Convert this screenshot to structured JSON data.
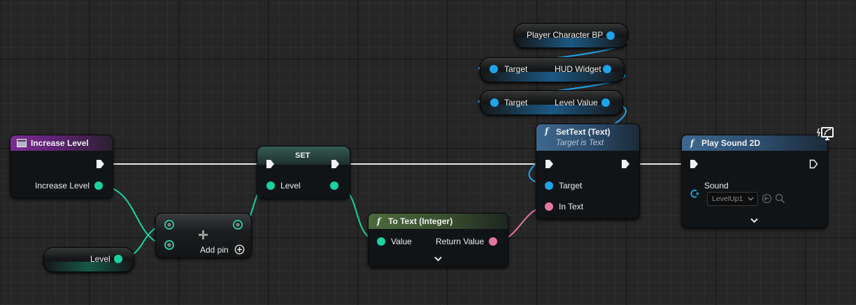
{
  "nodes": {
    "player_character_bp": {
      "label": "Player Character BP"
    },
    "hud_widget": {
      "target_label": "Target",
      "output_label": "HUD Widget"
    },
    "level_value": {
      "target_label": "Target",
      "output_label": "Level Value"
    },
    "increase_level": {
      "title": "Increase Level",
      "pin_label": "Increase  Level"
    },
    "level_getter": {
      "label": "Level"
    },
    "add": {
      "add_pin_label": "Add pin"
    },
    "set": {
      "title": "SET",
      "pin_label": "Level"
    },
    "to_text": {
      "title": "To Text (Integer)",
      "input_label": "Value",
      "output_label": "Return Value"
    },
    "set_text": {
      "title": "SetText (Text)",
      "subtitle": "Target is Text",
      "target_label": "Target",
      "in_text_label": "In Text"
    },
    "play_sound": {
      "title": "Play Sound 2D",
      "sound_label": "Sound",
      "sound_value": "LevelUp1"
    }
  },
  "icons": {
    "function": "f",
    "event": "event-icon",
    "add": "plus-icon",
    "expand": "chevron-down-icon",
    "latent": "clock-icon"
  },
  "colors": {
    "background": "#262626",
    "exec_wire": "#e6e6e6",
    "object_pin": "#1fa3ea",
    "integer_pin": "#19d2a0",
    "text_pin": "#e477a2",
    "event_header": "#7b2d92",
    "pure_header": "#4b6a3c",
    "function_header": "#3e6890"
  }
}
